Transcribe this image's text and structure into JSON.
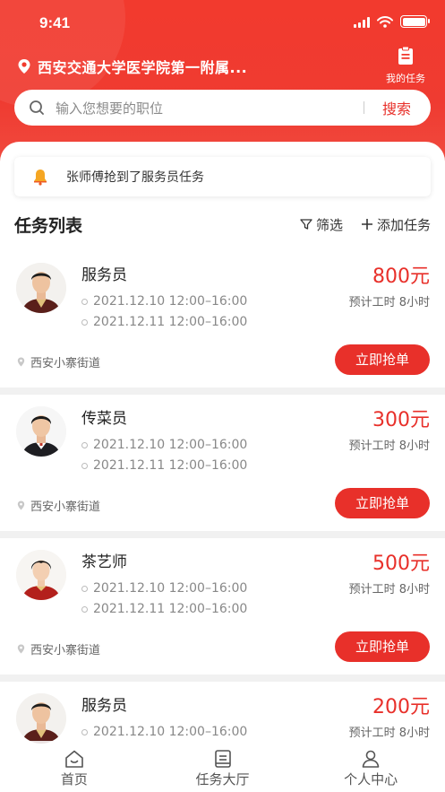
{
  "status_bar": {
    "time": "9:41"
  },
  "header": {
    "location": "西安交通大学医学院第一附属...",
    "my_tasks_label": "我的任务"
  },
  "search": {
    "placeholder": "输入您想要的职位",
    "button_label": "搜索"
  },
  "notice": {
    "text": "张师傅抢到了服务员任务"
  },
  "list": {
    "title": "任务列表",
    "filter_label": "筛选",
    "add_label": "添加任务"
  },
  "tasks": [
    {
      "title": "服务员",
      "price": "800元",
      "hours": "预计工时 8小时",
      "time1": "2021.12.10 12:00–16:00",
      "time2": "2021.12.11 12:00–16:00",
      "address": "西安小寨街道",
      "action": "立即抢单",
      "avatar": "male"
    },
    {
      "title": "传菜员",
      "price": "300元",
      "hours": "预计工时 8小时",
      "time1": "2021.12.10 12:00–16:00",
      "time2": "2021.12.11 12:00–16:00",
      "address": "西安小寨街道",
      "action": "立即抢单",
      "avatar": "male-2"
    },
    {
      "title": "茶艺师",
      "price": "500元",
      "hours": "预计工时 8小时",
      "time1": "2021.12.10 12:00–16:00",
      "time2": "2021.12.11 12:00–16:00",
      "address": "西安小寨街道",
      "action": "立即抢单",
      "avatar": "female"
    },
    {
      "title": "服务员",
      "price": "200元",
      "hours": "预计工时 8小时",
      "time1": "2021.12.10 12:00–16:00",
      "time2": "",
      "address": "",
      "action": "",
      "avatar": "male"
    }
  ],
  "tabbar": [
    {
      "label": "首页",
      "icon": "home-icon"
    },
    {
      "label": "任务大厅",
      "icon": "task-hall-icon"
    },
    {
      "label": "个人中心",
      "icon": "profile-icon"
    }
  ],
  "colors": {
    "accent": "#e8302a",
    "header": "#f23a2e"
  }
}
